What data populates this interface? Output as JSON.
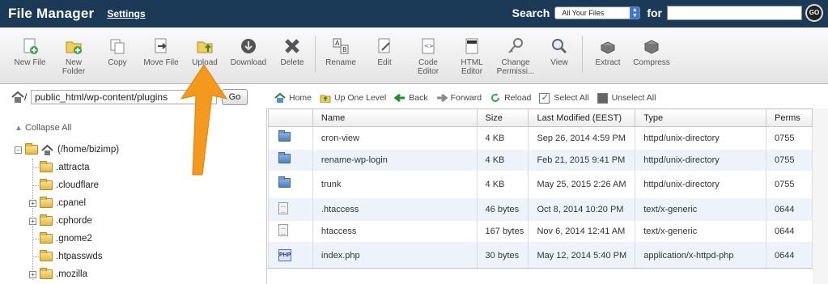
{
  "header": {
    "title": "File Manager",
    "settings_link": "Settings",
    "search_label": "Search",
    "search_scope": "All Your Files",
    "for_label": "for",
    "search_value": "",
    "go_label": "GO"
  },
  "toolbar": {
    "buttons": [
      {
        "label": "New File",
        "icon": "new-file-icon"
      },
      {
        "label": "New Folder",
        "icon": "new-folder-icon"
      },
      {
        "label": "Copy",
        "icon": "copy-icon"
      },
      {
        "label": "Move File",
        "icon": "move-file-icon"
      },
      {
        "label": "Upload",
        "icon": "upload-icon"
      },
      {
        "label": "Download",
        "icon": "download-icon"
      },
      {
        "label": "Delete",
        "icon": "delete-icon"
      },
      {
        "label": "Rename",
        "icon": "rename-icon"
      },
      {
        "label": "Edit",
        "icon": "edit-icon"
      },
      {
        "label": "Code Editor",
        "icon": "code-editor-icon"
      },
      {
        "label": "HTML Editor",
        "icon": "html-editor-icon"
      },
      {
        "label": "Change Permissi...",
        "icon": "change-permissions-icon"
      },
      {
        "label": "View",
        "icon": "view-icon"
      },
      {
        "label": "Extract",
        "icon": "extract-icon"
      },
      {
        "label": "Compress",
        "icon": "compress-icon"
      }
    ]
  },
  "path": {
    "slash": "/",
    "value": "public_html/wp-content/plugins",
    "go_label": "Go"
  },
  "tree": {
    "collapse_label": "Collapse All",
    "root_label": "(/home/bizimp)",
    "items": [
      {
        "label": ".attracta",
        "expandable": false
      },
      {
        "label": ".cloudflare",
        "expandable": false
      },
      {
        "label": ".cpanel",
        "expandable": true
      },
      {
        "label": ".cphorde",
        "expandable": true
      },
      {
        "label": ".gnome2",
        "expandable": false
      },
      {
        "label": ".htpasswds",
        "expandable": false
      },
      {
        "label": ".mozilla",
        "expandable": true
      }
    ]
  },
  "nav": {
    "home": "Home",
    "up": "Up One Level",
    "back": "Back",
    "forward": "Forward",
    "reload": "Reload",
    "select_all": "Select All",
    "unselect_all": "Unselect All"
  },
  "files": {
    "columns": [
      "Name",
      "Size",
      "Last Modified (EEST)",
      "Type",
      "Perms"
    ],
    "rows": [
      {
        "icon": "directory-icon",
        "name": "cron-view",
        "size": "4 KB",
        "modified": "Sep 26, 2014 4:59 PM",
        "type": "httpd/unix-directory",
        "perms": "0755"
      },
      {
        "icon": "directory-icon",
        "name": "rename-wp-login",
        "size": "4 KB",
        "modified": "Feb 21, 2015 9:41 PM",
        "type": "httpd/unix-directory",
        "perms": "0755"
      },
      {
        "icon": "directory-icon",
        "name": "trunk",
        "size": "4 KB",
        "modified": "May 25, 2015 2:26 AM",
        "type": "httpd/unix-directory",
        "perms": "0755"
      },
      {
        "icon": "text-file-icon",
        "name": ".htaccess",
        "size": "46 bytes",
        "modified": "Oct 8, 2014 10:20 PM",
        "type": "text/x-generic",
        "perms": "0644"
      },
      {
        "icon": "text-file-icon",
        "name": "htaccess",
        "size": "167 bytes",
        "modified": "Nov 6, 2014 12:41 AM",
        "type": "text/x-generic",
        "perms": "0644"
      },
      {
        "icon": "php-file-icon",
        "name": "index.php",
        "size": "30 bytes",
        "modified": "May 12, 2014 5:40 PM",
        "type": "application/x-httpd-php",
        "perms": "0644"
      }
    ]
  },
  "colors": {
    "header_bg": "#1b3a57",
    "row_alt": "#eef3fb",
    "arrow": "#f39a1e"
  }
}
